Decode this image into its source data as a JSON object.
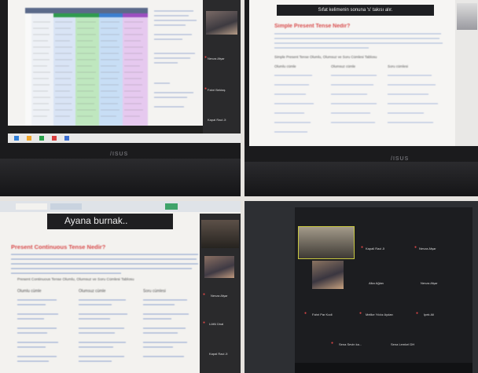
{
  "panels": {
    "top_left": {
      "brand": "/ISUS",
      "caption": "",
      "participants": [
        "Nevza Afşar",
        "Fahri Bektaş",
        "Kapal Raci Ji"
      ]
    },
    "top_right": {
      "banner": "Sıfat kelimenin sonuna 's' takısı alır.",
      "heading": "Simple Present Tense Nedir?",
      "table_heading": "Simple Present Tense Olumlu, Olumsuz ve Soru Cümlesi Tablosu",
      "columns": [
        "Olumlu cümle",
        "Olumsuz cümle",
        "Soru cümlesi"
      ],
      "brand": "/ISUS"
    },
    "bottom_left": {
      "title": "Ayana burnak..",
      "heading": "Present Continuous Tense Nedir?",
      "table_heading": "Present Continuous Tense Olumlu, Olumsuz ve Soru Cümlesi Tablosu",
      "columns": [
        "Olumlu cümle",
        "Olumsuz cümle",
        "Soru cümlesi"
      ],
      "participants": [
        "Nevza Afşar",
        "Lütfü Ünal",
        "Kapal Raci Ji"
      ]
    },
    "bottom_right": {
      "participants": [
        "Kapali Raci Ji",
        "Nevza Afşar",
        "Alka Ağlan",
        "Nevza Afşar",
        "Fahri Par Kodi",
        "Melike Yıldız Aydan",
        "Ipek Ali",
        "Sena Sevin ka...",
        "Sena Lemkel DH"
      ]
    }
  }
}
